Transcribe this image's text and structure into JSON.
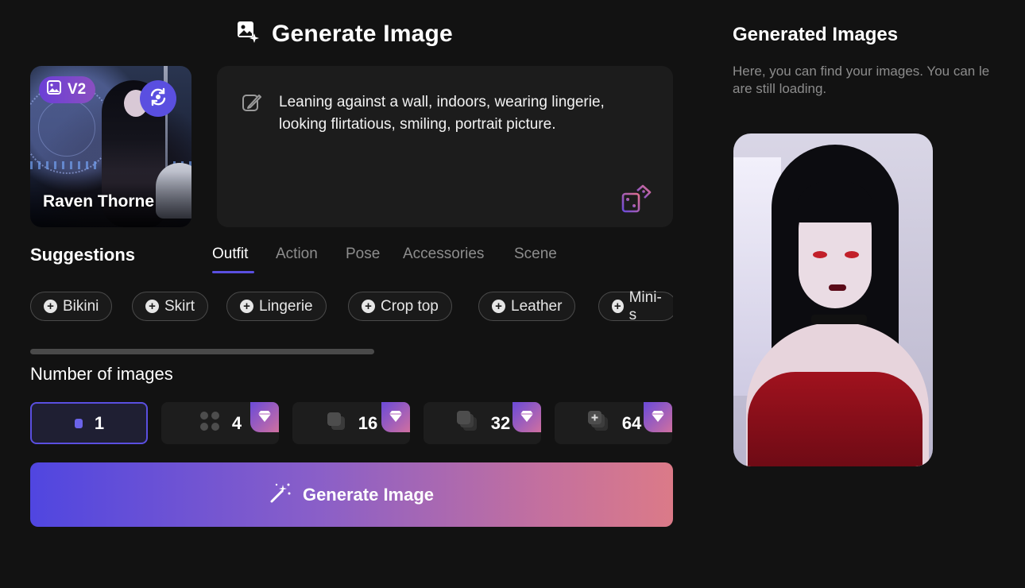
{
  "header": {
    "title": "Generate Image"
  },
  "character": {
    "name": "Raven Thorne",
    "version_badge": "V2"
  },
  "prompt": {
    "text": "Leaning against a wall, indoors, wearing lingerie, looking flirtatious, smiling, portrait picture."
  },
  "suggestions": {
    "title": "Suggestions",
    "tabs": [
      "Outfit",
      "Action",
      "Pose",
      "Accessories",
      "Scene"
    ],
    "active_tab": "Outfit",
    "chips": [
      "Bikini",
      "Skirt",
      "Lingerie",
      "Crop top",
      "Leather",
      "Mini-s"
    ]
  },
  "num_images": {
    "title": "Number of images",
    "options": [
      "1",
      "4",
      "16",
      "32",
      "64"
    ],
    "selected": "1"
  },
  "generate_button": {
    "label": "Generate Image"
  },
  "generated": {
    "title": "Generated Images",
    "description_line1": "Here, you can find your images. You can le",
    "description_line2": "are still loading."
  },
  "colors": {
    "accent": "#5a4fe0",
    "background": "#121212",
    "panel": "#1c1c1c",
    "gradient_end": "#db7a88"
  },
  "icons": [
    "image-add-sparkle-icon",
    "image-icon",
    "swap-character-icon",
    "pencil-icon",
    "dice-icon",
    "plus-icon",
    "diamond-icon",
    "magic-wand-icon"
  ]
}
